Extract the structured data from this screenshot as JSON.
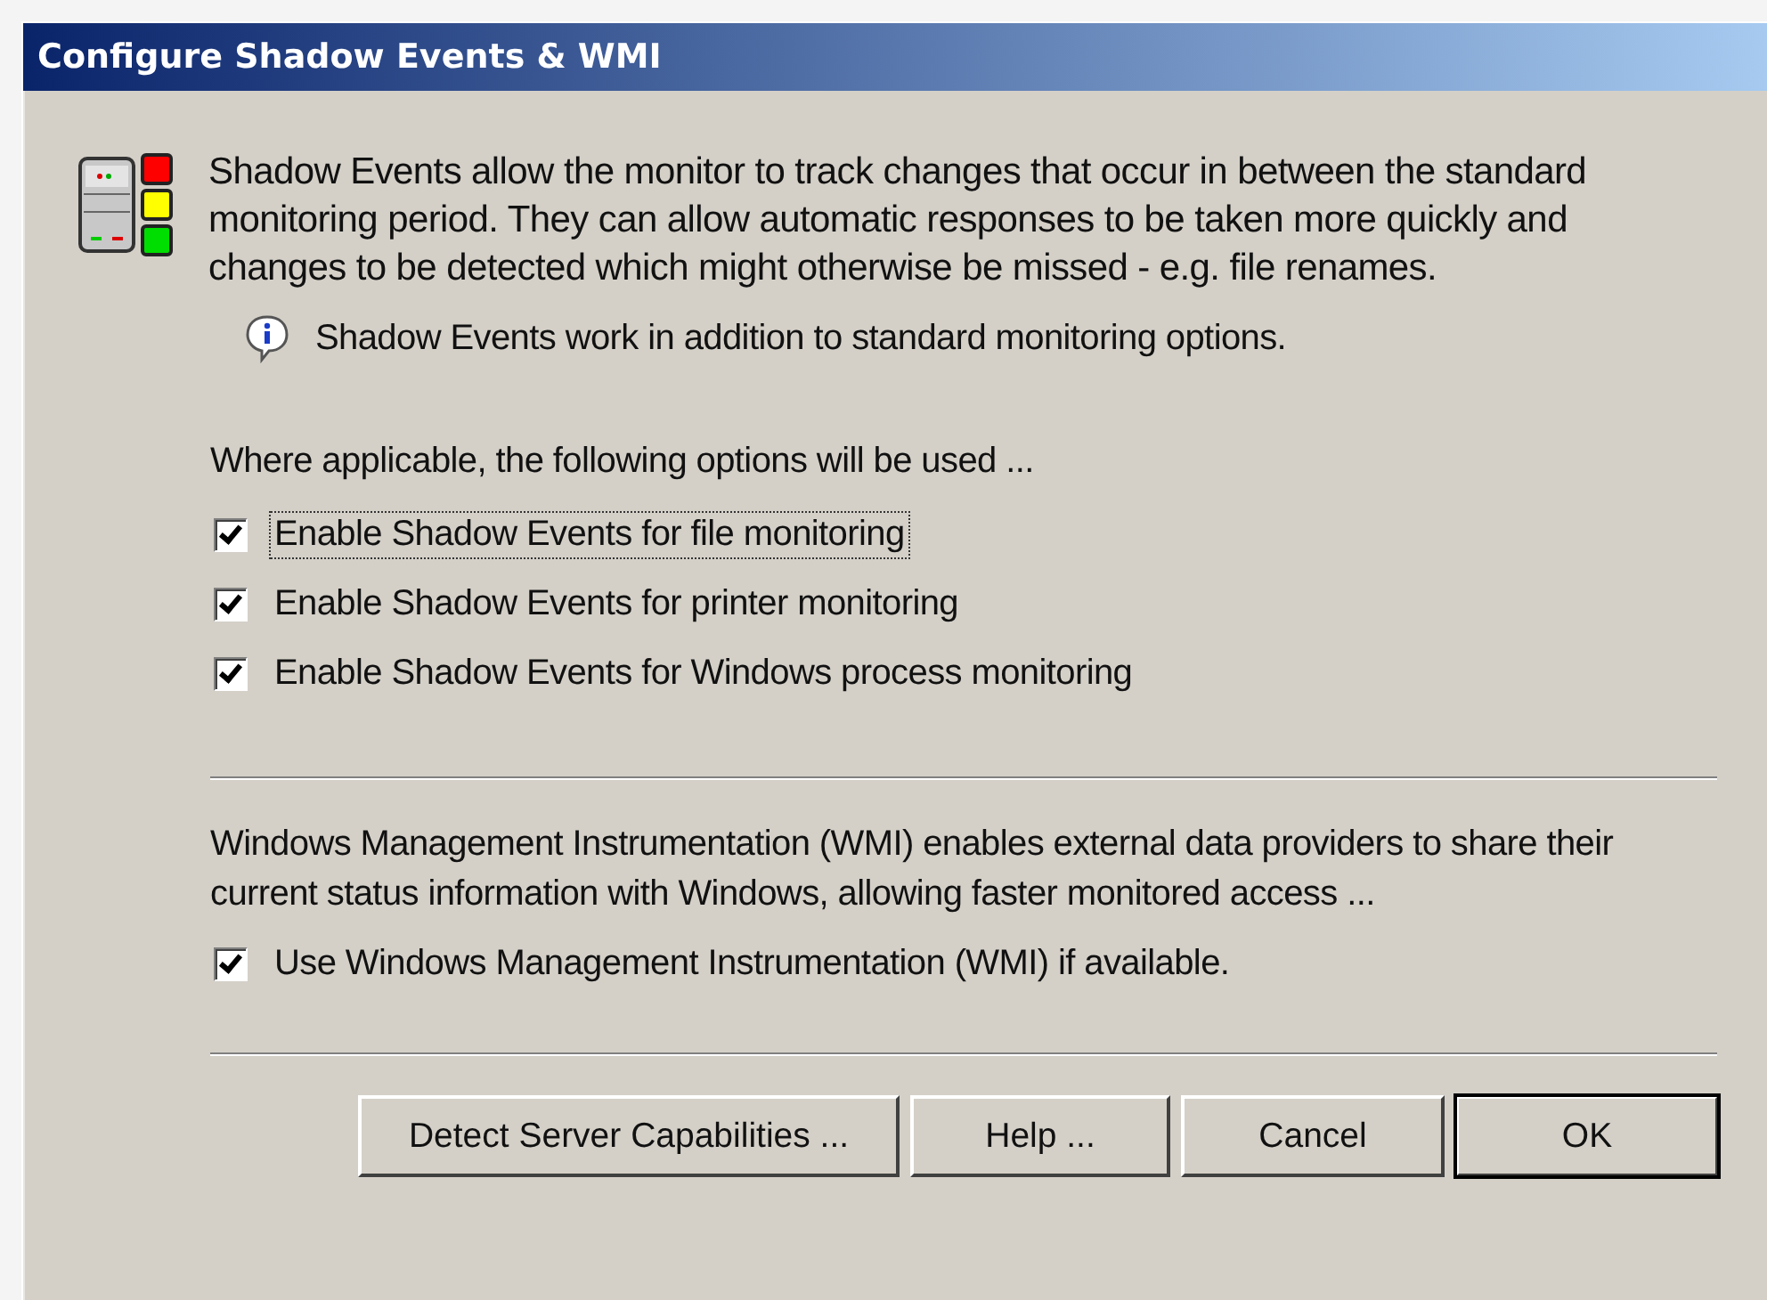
{
  "window": {
    "title": "Configure Shadow Events & WMI"
  },
  "intro": "Shadow Events allow the monitor to track changes that occur in between the standard monitoring period. They can allow automatic responses to be taken more quickly and changes to be detected which might otherwise be missed - e.g. file renames.",
  "info": "Shadow Events work in addition to standard monitoring options.",
  "options_heading": "Where applicable, the following options will be used ...",
  "options": [
    {
      "label": "Enable Shadow Events for file monitoring",
      "checked": true,
      "focused": true
    },
    {
      "label": "Enable Shadow Events for printer monitoring",
      "checked": true,
      "focused": false
    },
    {
      "label": "Enable Shadow Events for Windows process monitoring",
      "checked": true,
      "focused": false
    }
  ],
  "wmi_text": "Windows Management Instrumentation (WMI) enables external data providers to share their current status information with Windows, allowing faster monitored access ...",
  "wmi_option": {
    "label": "Use Windows Management Instrumentation (WMI) if available.",
    "checked": true,
    "focused": false
  },
  "buttons": [
    {
      "label": "Detect Server Capabilities ...",
      "default": false
    },
    {
      "label": "Help ...",
      "default": false
    },
    {
      "label": "Cancel",
      "default": false
    },
    {
      "label": "OK",
      "default": true
    }
  ]
}
